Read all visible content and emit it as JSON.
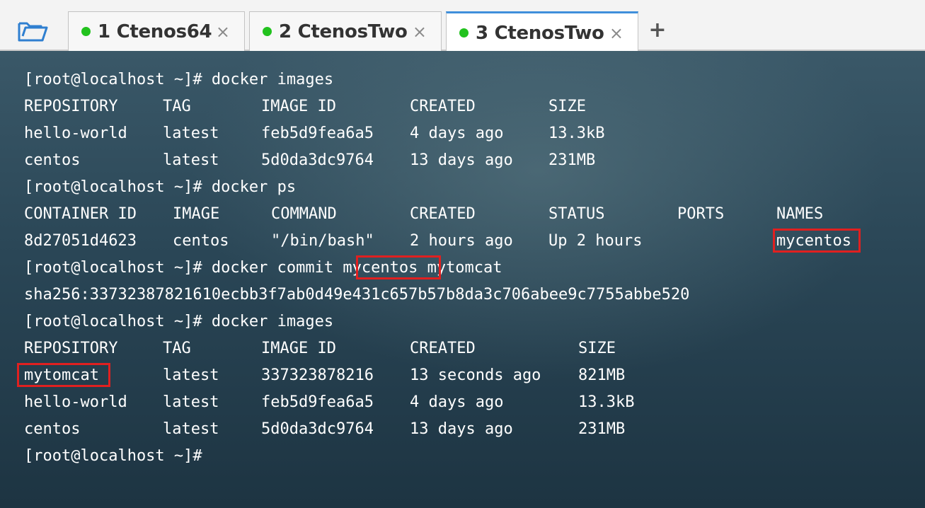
{
  "tabs": [
    {
      "number": "1",
      "name": "Ctenos64",
      "close": "×",
      "active": false
    },
    {
      "number": "2",
      "name": "CtenosTwo",
      "close": "×",
      "active": false
    },
    {
      "number": "3",
      "name": "CtenosTwo",
      "close": "×",
      "active": true
    }
  ],
  "add_tab_label": "+",
  "colors": {
    "tab_active_accent": "#3f8fdb",
    "status_dot": "#22c21e",
    "highlight_box": "#e02020",
    "terminal_text": "#ffffff"
  },
  "terminal": {
    "prompt": "[root@localhost ~]#",
    "lines": {
      "cmd1": " docker images",
      "img1_header": [
        "REPOSITORY",
        "TAG",
        "IMAGE ID",
        "CREATED",
        "SIZE"
      ],
      "img1_rows": [
        [
          "hello-world",
          "latest",
          "feb5d9fea6a5",
          "4 days ago",
          "13.3kB"
        ],
        [
          "centos",
          "latest",
          "5d0da3dc9764",
          "13 days ago",
          "231MB"
        ]
      ],
      "cmd2": " docker ps",
      "ps_header": [
        "CONTAINER ID",
        "IMAGE",
        "COMMAND",
        "CREATED",
        "STATUS",
        "PORTS",
        "NAMES"
      ],
      "ps_row": [
        "8d27051d4623",
        "centos",
        "\"/bin/bash\"",
        "2 hours ago",
        "Up 2 hours",
        "",
        "mycentos"
      ],
      "cmd3_pre": " docker commit ",
      "cmd3_name": "mycentos",
      "cmd3_post": " mytomcat",
      "sha": "sha256:33732387821610ecbb3f7ab0d49e431c657b57b8da3c706abee9c7755abbe520",
      "cmd4": " docker images",
      "img2_header": [
        "REPOSITORY",
        "TAG",
        "IMAGE ID",
        "CREATED",
        "SIZE"
      ],
      "img2_rows": [
        [
          "mytomcat",
          "latest",
          "337323878216",
          "13 seconds ago",
          "821MB"
        ],
        [
          "hello-world",
          "latest",
          "feb5d9fea6a5",
          "4 days ago",
          "13.3kB"
        ],
        [
          "centos",
          "latest",
          "5d0da3dc9764",
          "13 days ago",
          "231MB"
        ]
      ]
    }
  }
}
